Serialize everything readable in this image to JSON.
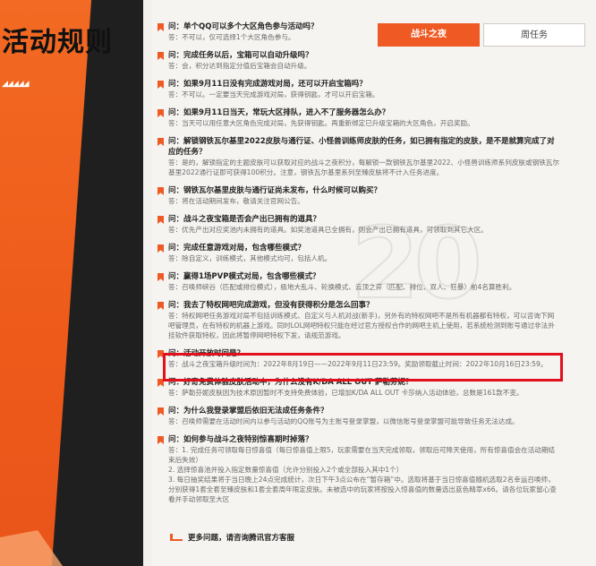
{
  "sidebar": {
    "title": "活动规则",
    "decoration": "◢◢◢◢◢"
  },
  "tabs": [
    {
      "label": "战斗之夜",
      "active": true
    },
    {
      "label": "周任务",
      "active": false
    }
  ],
  "watermark": "20",
  "faq": [
    {
      "q": "问：单个QQ可以多个大区角色参与活动吗？",
      "a": "答：不可以，仅可选择1个大区角色参与。"
    },
    {
      "q": "问：完成任务以后，宝箱可以自动升级吗？",
      "a": "答：会，积分达到指定分值后宝箱会自动升级。"
    },
    {
      "q": "问：如果9月11日没有完成游戏对局，还可以开启宝箱吗？",
      "a": "答：不可以。一定要当天完成游戏对局，获得钥匙，才可以开启宝箱。"
    },
    {
      "q": "问：如果9月11日当天，常玩大区排队，进入不了服务器怎么办？",
      "a": "答：当天可以用任意大区角色完成对局，先获得钥匙。再重新绑定已升级宝箱的大区角色，开启奖励。"
    },
    {
      "q": "问：解锁钢铁瓦尔基里2022皮肤与通行证、小怪兽训练师皮肤的任务，如已拥有指定的皮肤，是不是就算完成了对应的任务？",
      "a": "答：是的，解锁指定的主题皮肤可以获取对应的战斗之夜积分，每解锁一款钢铁瓦尔基里2022、小怪兽训练师系列皮肤或钢铁瓦尔基里2022通行证即可获得100积分。注意，钢铁瓦尔基里系列至臻皮肤将不计入任务进度。"
    },
    {
      "q": "问：钢铁瓦尔基里皮肤与通行证尚未发布，什么时候可以购买？",
      "a": "答：将在活动期间发布，敬请关注官网公告。"
    },
    {
      "q": "问：战斗之夜宝箱是否会产出已拥有的道具？",
      "a": "答：优先产出对应奖池内未拥有的道具。如奖池道具已全拥有，则会产出已拥有道具，可领取到其它大区。"
    },
    {
      "q": "问：完成任意游戏对局，包含哪些模式？",
      "a": "答：除自定义，训练模式，其他模式均可，包括人机。"
    },
    {
      "q": "问：赢得1场PVP模式对局，包含哪些模式？",
      "a": "答：召唤师峡谷（匹配或排位模式），极地大乱斗、轮换模式、云顶之弈（匹配、排位、双人、狂暴）前4名算胜利。"
    },
    {
      "q": "问：我去了特权网吧完成游戏，但没有获得积分是怎么回事？",
      "a": "答：特权网吧任务游戏对局不包括训练模式、自定义与人机对战(新手)，另外有的特权网吧不是所有机器都有特权，可以咨询下网吧管理员，在有特权的机器上游戏。同时LOL网吧特权只能在经过官方授权合作的网吧主机上使用，若系统检测到账号通过非法外挂软件获取特权，因此将暂停网吧特权下发，请规范游戏。"
    },
    {
      "q": "问：活动开放时间是？",
      "a": "答：战斗之夜宝箱升级时间为：2022年8月19日——2022年9月11日23:59。奖励领取截止时间：2022年10月16日23:59。"
    },
    {
      "q": "问：好奇免费体验皮肤活动中，为什么没有K/DA ALL OUT 萨勒芬妮？",
      "a": "答：萨勒芬妮皮肤因为技术原因暂时不支持免费体验，已增加K/DA ALL OUT 卡莎纳入活动体验，总数是161款不变。"
    },
    {
      "q": "问：为什么我登录掌盟后依旧无法成任务条件？",
      "a": "答：召唤师需要在活动时间内以参与活动的QQ账号为主账号登录掌盟，以微信账号登录掌盟可能导致任务无法达成。"
    },
    {
      "q": "问：如何参与战斗之夜特别惊喜期时掉落？",
      "a": "答：1. 完成任务可领取每日惊喜值（每日惊喜值上限5，玩家需要在当天完成领取，领取后可降天使用，所有惊喜值会在活动期结束后失效）\n2. 选择惊喜池并投入指定数量惊喜值（允许分别投入2个或全部投入其中1个）\n3. 每日抽奖结果将于当日晚上24点完成统计，次日下午3点公布在“暂存箱”中。选取将基于当日惊喜值随机选取2名幸运召唤师，分别获得1套全套至臻皮肤和1套全套周年限定皮肤。未被选中的玩家将按投入惊喜值的数量选出蓝色精萃x66。请各位玩家留心查看并手动领取至大区"
    }
  ],
  "footer": {
    "more_label": "更多问题，请咨询腾讯官方客服"
  }
}
